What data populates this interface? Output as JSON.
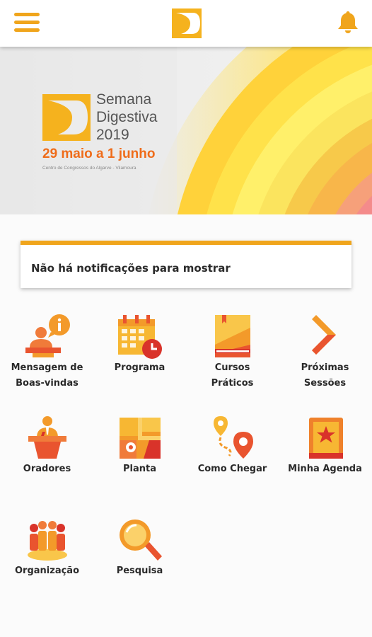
{
  "header": {
    "menu_icon": "hamburger-menu-icon",
    "logo": "semana-digestiva-logo",
    "bell_icon": "bell-icon",
    "accent": "#f0a51c"
  },
  "banner": {
    "title_line1": "Semana",
    "title_line2": "Digestiva",
    "title_line3": "2019",
    "dates": "29 maio a 1 junho",
    "venue": "Centro de Congressos do Algarve - Vilamoura",
    "date_color": "#ef6c1a"
  },
  "notification": {
    "text": "Não há notificações para mostrar"
  },
  "menu": [
    {
      "label_line1": "Mensagem de",
      "label_line2": "Boas-vindas",
      "icon": "welcome-message-icon"
    },
    {
      "label_line1": "Programa",
      "label_line2": "",
      "icon": "calendar-icon"
    },
    {
      "label_line1": "Cursos",
      "label_line2": "Práticos",
      "icon": "book-icon"
    },
    {
      "label_line1": "Próximas",
      "label_line2": "Sessões",
      "icon": "chevron-right-icon"
    },
    {
      "label_line1": "Oradores",
      "label_line2": "",
      "icon": "speaker-podium-icon"
    },
    {
      "label_line1": "Planta",
      "label_line2": "",
      "icon": "map-icon"
    },
    {
      "label_line1": "Como Chegar",
      "label_line2": "",
      "icon": "directions-pin-icon"
    },
    {
      "label_line1": "Minha Agenda",
      "label_line2": "",
      "icon": "starred-agenda-icon"
    },
    {
      "label_line1": "Organização",
      "label_line2": "",
      "icon": "team-icon"
    },
    {
      "label_line1": "Pesquisa",
      "label_line2": "",
      "icon": "search-magnifier-icon"
    }
  ]
}
